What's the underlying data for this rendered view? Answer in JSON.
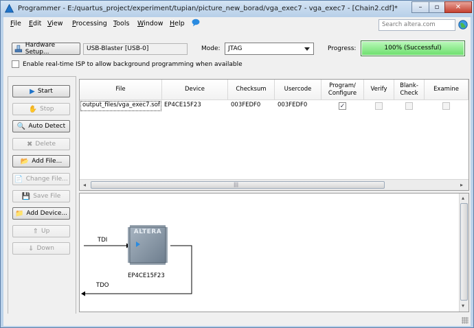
{
  "window": {
    "title": "Programmer - E:/quartus_project/experiment/tupian/picture_new_borad/vga_exec7 - vga_exec7 - [Chain2.cdf]*",
    "minimize": "–",
    "maximize": "▫",
    "close": "✕"
  },
  "menu": {
    "items": [
      {
        "u": "F",
        "rest": "ile"
      },
      {
        "u": "E",
        "rest": "dit"
      },
      {
        "u": "V",
        "rest": "iew"
      },
      {
        "u": "P",
        "rest": "rocessing"
      },
      {
        "u": "T",
        "rest": "ools"
      },
      {
        "u": "W",
        "rest": "indow"
      },
      {
        "u": "H",
        "rest": "elp"
      }
    ],
    "search_placeholder": "Search altera.com"
  },
  "toolbar": {
    "hardware_setup": "Hardware Setup...",
    "hardware_value": "USB-Blaster [USB-0]",
    "mode_label": "Mode:",
    "mode_value": "JTAG",
    "progress_label": "Progress:",
    "progress_text": "100% (Successful)",
    "progress_percent": 100,
    "isp_label": "Enable real-time ISP to allow background programming when available"
  },
  "buttons": [
    {
      "label": "Start",
      "icon": "start-icon",
      "glyph": "▶",
      "enabled": true
    },
    {
      "label": "Stop",
      "icon": "stop-icon",
      "glyph": "✋",
      "enabled": false
    },
    {
      "label": "Auto Detect",
      "icon": "auto-detect-icon",
      "glyph": "🔍",
      "enabled": true
    },
    {
      "label": "Delete",
      "icon": "delete-icon",
      "glyph": "✖",
      "enabled": false
    },
    {
      "label": "Add File...",
      "icon": "add-file-icon",
      "glyph": "📂",
      "enabled": true
    },
    {
      "label": "Change File...",
      "icon": "change-file-icon",
      "glyph": "📄",
      "enabled": false
    },
    {
      "label": "Save File",
      "icon": "save-file-icon",
      "glyph": "💾",
      "enabled": false
    },
    {
      "label": "Add Device...",
      "icon": "add-device-icon",
      "glyph": "📁",
      "enabled": true
    },
    {
      "label": "Up",
      "icon": "up-icon",
      "glyph": "⇑",
      "enabled": false
    },
    {
      "label": "Down",
      "icon": "down-icon",
      "glyph": "⇓",
      "enabled": false
    }
  ],
  "table": {
    "headers": [
      "File",
      "Device",
      "Checksum",
      "Usercode",
      "Program/ Configure",
      "Verify",
      "Blank- Check",
      "Examine"
    ],
    "row": {
      "file": "output_files/vga_exec7.sof",
      "device": "EP4CE15F23",
      "checksum": "003FEDF0",
      "usercode": "003FEDF0",
      "program_configure": true,
      "verify": false,
      "blank_check": false,
      "examine": false
    }
  },
  "chain": {
    "tdi": "TDI",
    "tdo": "TDO",
    "chip_brand": "ALTERA",
    "device_label": "EP4CE15F23"
  },
  "colors": {
    "progress_fill": "#6ee06e",
    "chip_body": "#7e8e9e",
    "accent_blue": "#1f73c9"
  }
}
